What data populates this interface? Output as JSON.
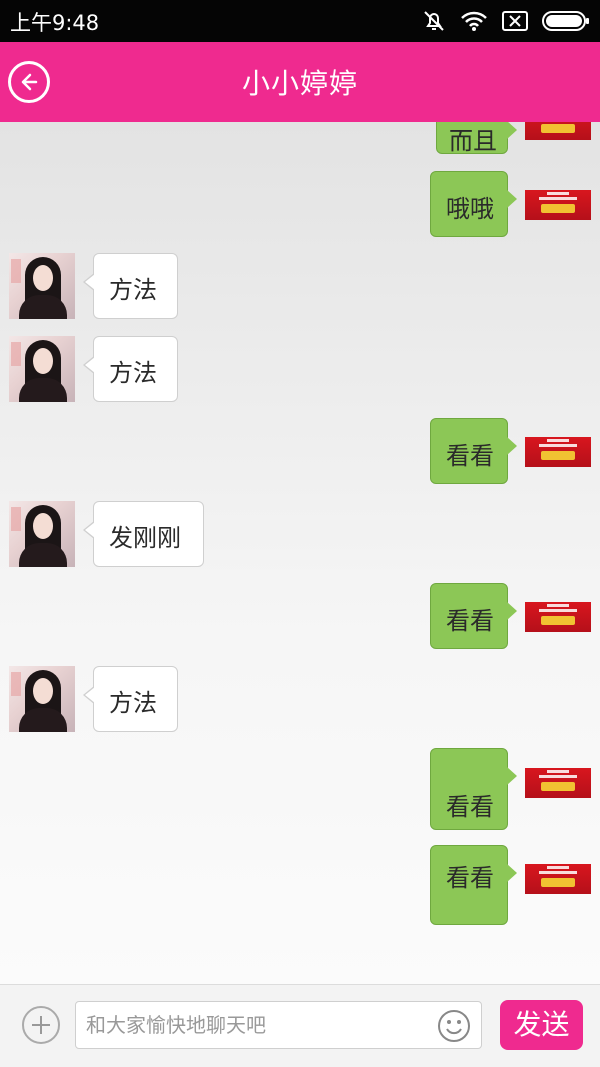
{
  "status_bar": {
    "time": "上午9:48",
    "icons": [
      "bell-off-icon",
      "wifi-icon",
      "sim-icon",
      "battery-icon"
    ]
  },
  "header": {
    "title": "小小婷婷",
    "back_icon": "back-arrow-icon"
  },
  "colors": {
    "brand": "#ef2a8f",
    "outgoing_bubble": "#8cc756",
    "incoming_bubble": "#ffffff"
  },
  "messages": [
    {
      "direction": "out",
      "text": "而且"
    },
    {
      "direction": "out",
      "text": "哦哦"
    },
    {
      "direction": "in",
      "text": "方法"
    },
    {
      "direction": "in",
      "text": "方法"
    },
    {
      "direction": "out",
      "text": "看看"
    },
    {
      "direction": "in",
      "text": "发刚刚"
    },
    {
      "direction": "out",
      "text": "看看"
    },
    {
      "direction": "in",
      "text": "方法"
    },
    {
      "direction": "out",
      "text": "看看"
    },
    {
      "direction": "out",
      "text": "看看"
    }
  ],
  "composer": {
    "placeholder": "和大家愉快地聊天吧",
    "send_label": "发送",
    "add_icon": "plus-circle-icon",
    "emoji_icon": "smiley-icon"
  }
}
